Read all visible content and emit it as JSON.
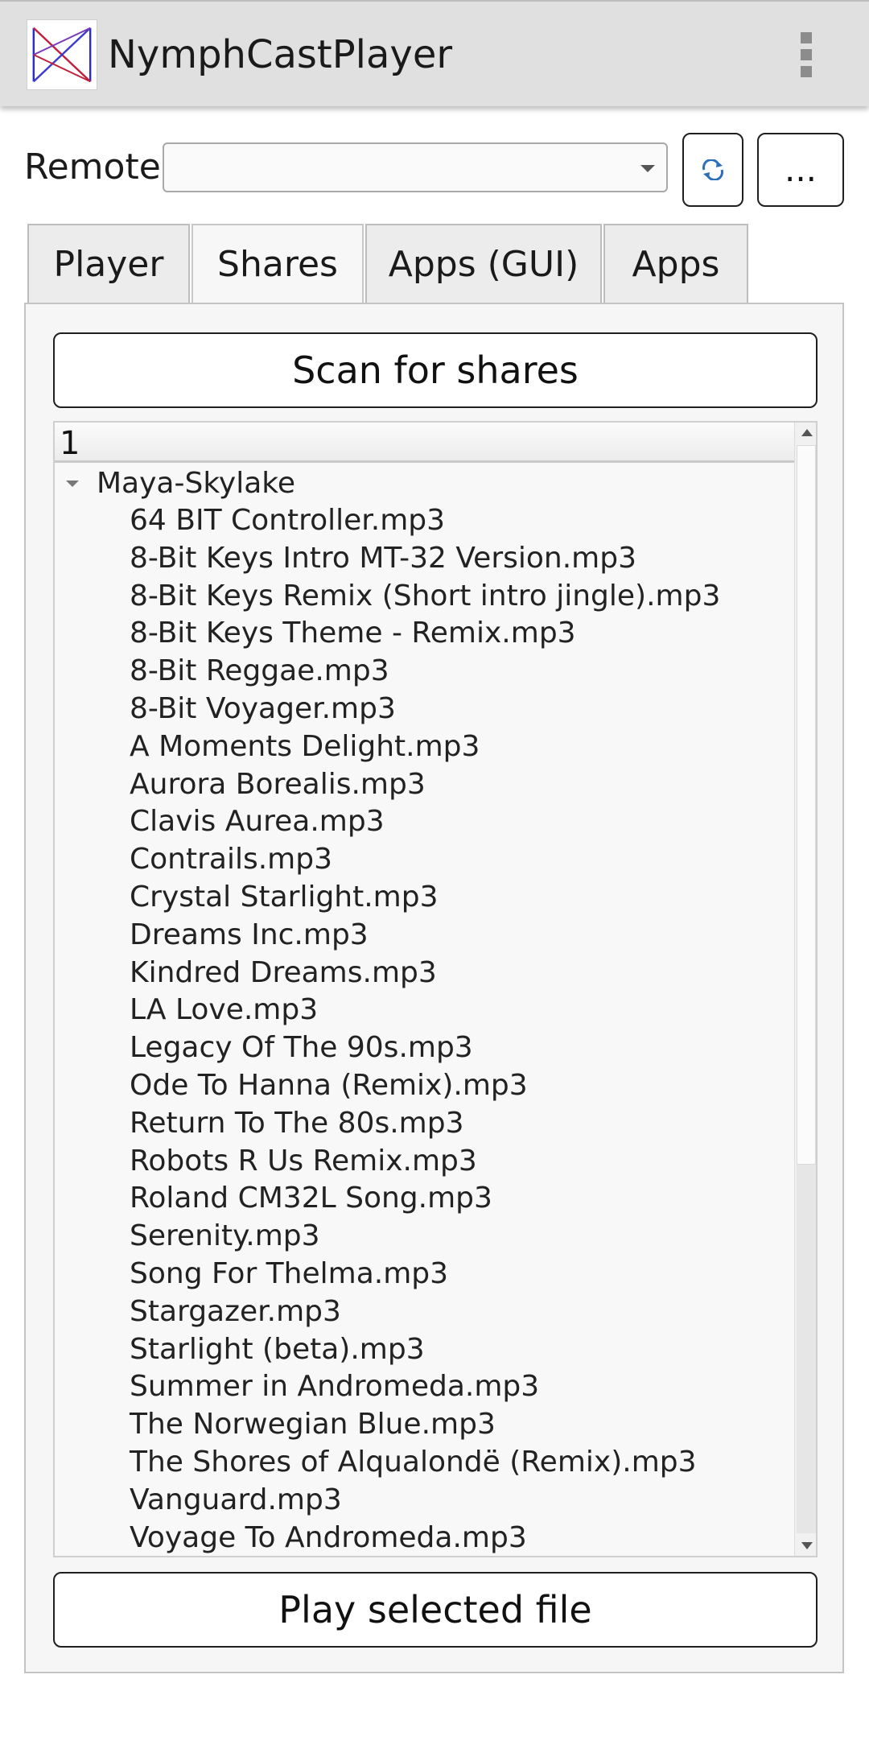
{
  "window": {
    "title": "NymphCastPlayer",
    "logo_icon": "nymphcast-logo-icon",
    "menu_icon": "overflow-menu-icon"
  },
  "remote": {
    "label": "Remote",
    "selected_value": "",
    "refresh_icon": "refresh-icon",
    "more_label": "..."
  },
  "tabs": [
    {
      "label": "Player"
    },
    {
      "label": "Shares",
      "active": true
    },
    {
      "label": "Apps (GUI)"
    },
    {
      "label": "Apps"
    }
  ],
  "shares": {
    "scan_label": "Scan for shares",
    "column_header": "1",
    "root_label": "Maya-Skylake",
    "files": [
      "64 BIT Controller.mp3",
      "8-Bit Keys Intro MT-32 Version.mp3",
      "8-Bit Keys Remix (Short intro jingle).mp3",
      "8-Bit Keys Theme - Remix.mp3",
      "8-Bit Reggae.mp3",
      "8-Bit Voyager.mp3",
      "A Moments Delight.mp3",
      "Aurora Borealis.mp3",
      "Clavis Aurea.mp3",
      "Contrails.mp3",
      "Crystal Starlight.mp3",
      "Dreams Inc.mp3",
      "Kindred Dreams.mp3",
      "LA Love.mp3",
      "Legacy Of The 90s.mp3",
      "Ode To Hanna (Remix).mp3",
      "Return To The 80s.mp3",
      "Robots R Us Remix.mp3",
      "Roland CM32L Song.mp3",
      "Serenity.mp3",
      "Song For Thelma.mp3",
      "Stargazer.mp3",
      "Starlight (beta).mp3",
      "Summer in Andromeda.mp3",
      "The Norwegian Blue.mp3",
      "The Shores of Alqualondë (Remix).mp3",
      "Vanguard.mp3",
      "Voyage To Andromeda.mp3"
    ],
    "play_label": "Play selected file"
  },
  "colors": {
    "titlebar": "#e0e0e0",
    "refresh_icon": "#2a6fb8",
    "logo_blue": "#2b2bd6",
    "logo_red": "#c0203a"
  }
}
